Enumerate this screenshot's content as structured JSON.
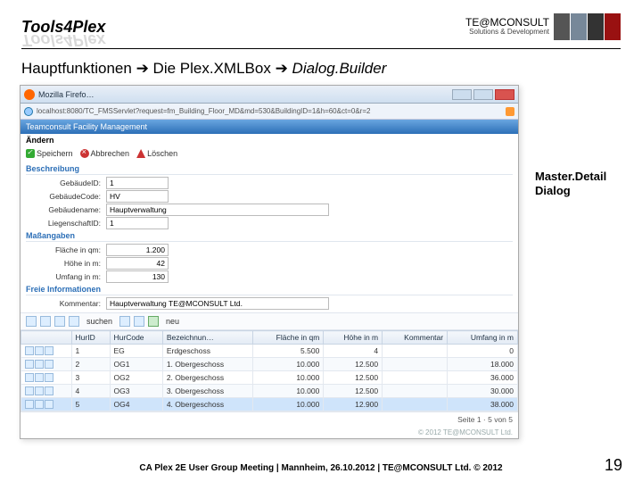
{
  "slide": {
    "logo_left": "Tools4Plex",
    "logo_right_line1": "TE@MCONSULT",
    "logo_right_line2": "Solutions & Development",
    "title_parts": [
      "Hauptfunktionen",
      "Die Plex.XMLBox",
      "Dialog.Builder"
    ],
    "annotation": "Master.Detail\nDialog",
    "footer": "CA Plex 2E User Group Meeting | Mannheim, 26.10.2012 | TE@MCONSULT Ltd. © 2012",
    "page_number": "19"
  },
  "window": {
    "app_title": "Mozilla Firefo…",
    "url": "localhost:8080/TC_FMSServlet?request=fm_Building_Floor_MD&md=530&BuildingID=1&h=60&ct=0&r=2",
    "page_title": "Teamconsult Facility Management"
  },
  "form": {
    "operation": "Ändern",
    "btn_save": "Speichern",
    "btn_cancel": "Abbrechen",
    "btn_delete": "Löschen",
    "section_descr": "Beschreibung",
    "section_measure": "Maßangaben",
    "section_free": "Freie Informationen",
    "fields": {
      "gebaeude_id_lbl": "GebäudeID:",
      "gebaeude_id": "1",
      "gebaeudecode_lbl": "GebäudeCode:",
      "gebaeudecode": "HV",
      "gebaeudename_lbl": "Gebäudename:",
      "gebaeudename": "Hauptverwaltung",
      "liegenschaft_lbl": "LiegenschaftID:",
      "liegenschaft": "1",
      "flaeche_lbl": "Fläche in qm:",
      "flaeche": "1.200",
      "hoehe_lbl": "Höhe in m:",
      "hoehe": "42",
      "umfang_lbl": "Umfang in m:",
      "umfang": "130",
      "kommentar_lbl": "Kommentar:",
      "kommentar": "Hauptverwaltung TE@MCONSULT Ltd."
    }
  },
  "gridtoolbar": {
    "suchen": "suchen",
    "neu": "neu"
  },
  "grid": {
    "cols": [
      "",
      "HurID",
      "HurCode",
      "Bezeichnun…",
      "Fläche in qm",
      "Höhe in m",
      "Kommentar",
      "Umfang in m"
    ],
    "rows": [
      {
        "id": "1",
        "code": "EG",
        "name": "Erdgeschoss",
        "flaeche": "5.500",
        "hoehe": "4",
        "kommentar": "",
        "umfang": "0"
      },
      {
        "id": "2",
        "code": "OG1",
        "name": "1. Obergeschoss",
        "flaeche": "10.000",
        "hoehe": "12.500",
        "kommentar": "",
        "umfang": "18.000"
      },
      {
        "id": "3",
        "code": "OG2",
        "name": "2. Obergeschoss",
        "flaeche": "10.000",
        "hoehe": "12.500",
        "kommentar": "",
        "umfang": "36.000"
      },
      {
        "id": "4",
        "code": "OG3",
        "name": "3. Obergeschoss",
        "flaeche": "10.000",
        "hoehe": "12.500",
        "kommentar": "",
        "umfang": "30.000"
      },
      {
        "id": "5",
        "code": "OG4",
        "name": "4. Obergeschoss",
        "flaeche": "10.000",
        "hoehe": "12.900",
        "kommentar": "",
        "umfang": "38.000"
      }
    ],
    "pager": "Seite 1 · 5 von 5",
    "copyright": "© 2012 TE@MCONSULT Ltd."
  }
}
